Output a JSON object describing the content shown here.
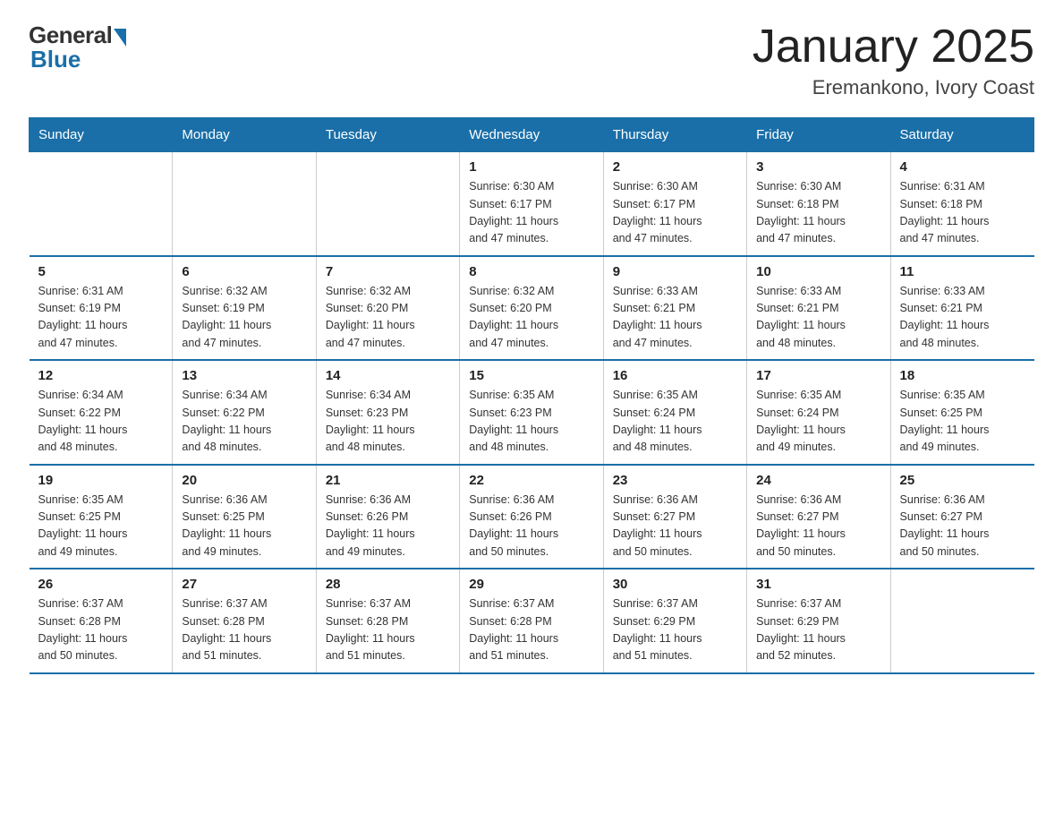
{
  "header": {
    "logo_general": "General",
    "logo_blue": "Blue",
    "month_title": "January 2025",
    "location": "Eremankono, Ivory Coast"
  },
  "days_of_week": [
    "Sunday",
    "Monday",
    "Tuesday",
    "Wednesday",
    "Thursday",
    "Friday",
    "Saturday"
  ],
  "weeks": [
    [
      {
        "day": "",
        "info": ""
      },
      {
        "day": "",
        "info": ""
      },
      {
        "day": "",
        "info": ""
      },
      {
        "day": "1",
        "info": "Sunrise: 6:30 AM\nSunset: 6:17 PM\nDaylight: 11 hours\nand 47 minutes."
      },
      {
        "day": "2",
        "info": "Sunrise: 6:30 AM\nSunset: 6:17 PM\nDaylight: 11 hours\nand 47 minutes."
      },
      {
        "day": "3",
        "info": "Sunrise: 6:30 AM\nSunset: 6:18 PM\nDaylight: 11 hours\nand 47 minutes."
      },
      {
        "day": "4",
        "info": "Sunrise: 6:31 AM\nSunset: 6:18 PM\nDaylight: 11 hours\nand 47 minutes."
      }
    ],
    [
      {
        "day": "5",
        "info": "Sunrise: 6:31 AM\nSunset: 6:19 PM\nDaylight: 11 hours\nand 47 minutes."
      },
      {
        "day": "6",
        "info": "Sunrise: 6:32 AM\nSunset: 6:19 PM\nDaylight: 11 hours\nand 47 minutes."
      },
      {
        "day": "7",
        "info": "Sunrise: 6:32 AM\nSunset: 6:20 PM\nDaylight: 11 hours\nand 47 minutes."
      },
      {
        "day": "8",
        "info": "Sunrise: 6:32 AM\nSunset: 6:20 PM\nDaylight: 11 hours\nand 47 minutes."
      },
      {
        "day": "9",
        "info": "Sunrise: 6:33 AM\nSunset: 6:21 PM\nDaylight: 11 hours\nand 47 minutes."
      },
      {
        "day": "10",
        "info": "Sunrise: 6:33 AM\nSunset: 6:21 PM\nDaylight: 11 hours\nand 48 minutes."
      },
      {
        "day": "11",
        "info": "Sunrise: 6:33 AM\nSunset: 6:21 PM\nDaylight: 11 hours\nand 48 minutes."
      }
    ],
    [
      {
        "day": "12",
        "info": "Sunrise: 6:34 AM\nSunset: 6:22 PM\nDaylight: 11 hours\nand 48 minutes."
      },
      {
        "day": "13",
        "info": "Sunrise: 6:34 AM\nSunset: 6:22 PM\nDaylight: 11 hours\nand 48 minutes."
      },
      {
        "day": "14",
        "info": "Sunrise: 6:34 AM\nSunset: 6:23 PM\nDaylight: 11 hours\nand 48 minutes."
      },
      {
        "day": "15",
        "info": "Sunrise: 6:35 AM\nSunset: 6:23 PM\nDaylight: 11 hours\nand 48 minutes."
      },
      {
        "day": "16",
        "info": "Sunrise: 6:35 AM\nSunset: 6:24 PM\nDaylight: 11 hours\nand 48 minutes."
      },
      {
        "day": "17",
        "info": "Sunrise: 6:35 AM\nSunset: 6:24 PM\nDaylight: 11 hours\nand 49 minutes."
      },
      {
        "day": "18",
        "info": "Sunrise: 6:35 AM\nSunset: 6:25 PM\nDaylight: 11 hours\nand 49 minutes."
      }
    ],
    [
      {
        "day": "19",
        "info": "Sunrise: 6:35 AM\nSunset: 6:25 PM\nDaylight: 11 hours\nand 49 minutes."
      },
      {
        "day": "20",
        "info": "Sunrise: 6:36 AM\nSunset: 6:25 PM\nDaylight: 11 hours\nand 49 minutes."
      },
      {
        "day": "21",
        "info": "Sunrise: 6:36 AM\nSunset: 6:26 PM\nDaylight: 11 hours\nand 49 minutes."
      },
      {
        "day": "22",
        "info": "Sunrise: 6:36 AM\nSunset: 6:26 PM\nDaylight: 11 hours\nand 50 minutes."
      },
      {
        "day": "23",
        "info": "Sunrise: 6:36 AM\nSunset: 6:27 PM\nDaylight: 11 hours\nand 50 minutes."
      },
      {
        "day": "24",
        "info": "Sunrise: 6:36 AM\nSunset: 6:27 PM\nDaylight: 11 hours\nand 50 minutes."
      },
      {
        "day": "25",
        "info": "Sunrise: 6:36 AM\nSunset: 6:27 PM\nDaylight: 11 hours\nand 50 minutes."
      }
    ],
    [
      {
        "day": "26",
        "info": "Sunrise: 6:37 AM\nSunset: 6:28 PM\nDaylight: 11 hours\nand 50 minutes."
      },
      {
        "day": "27",
        "info": "Sunrise: 6:37 AM\nSunset: 6:28 PM\nDaylight: 11 hours\nand 51 minutes."
      },
      {
        "day": "28",
        "info": "Sunrise: 6:37 AM\nSunset: 6:28 PM\nDaylight: 11 hours\nand 51 minutes."
      },
      {
        "day": "29",
        "info": "Sunrise: 6:37 AM\nSunset: 6:28 PM\nDaylight: 11 hours\nand 51 minutes."
      },
      {
        "day": "30",
        "info": "Sunrise: 6:37 AM\nSunset: 6:29 PM\nDaylight: 11 hours\nand 51 minutes."
      },
      {
        "day": "31",
        "info": "Sunrise: 6:37 AM\nSunset: 6:29 PM\nDaylight: 11 hours\nand 52 minutes."
      },
      {
        "day": "",
        "info": ""
      }
    ]
  ]
}
